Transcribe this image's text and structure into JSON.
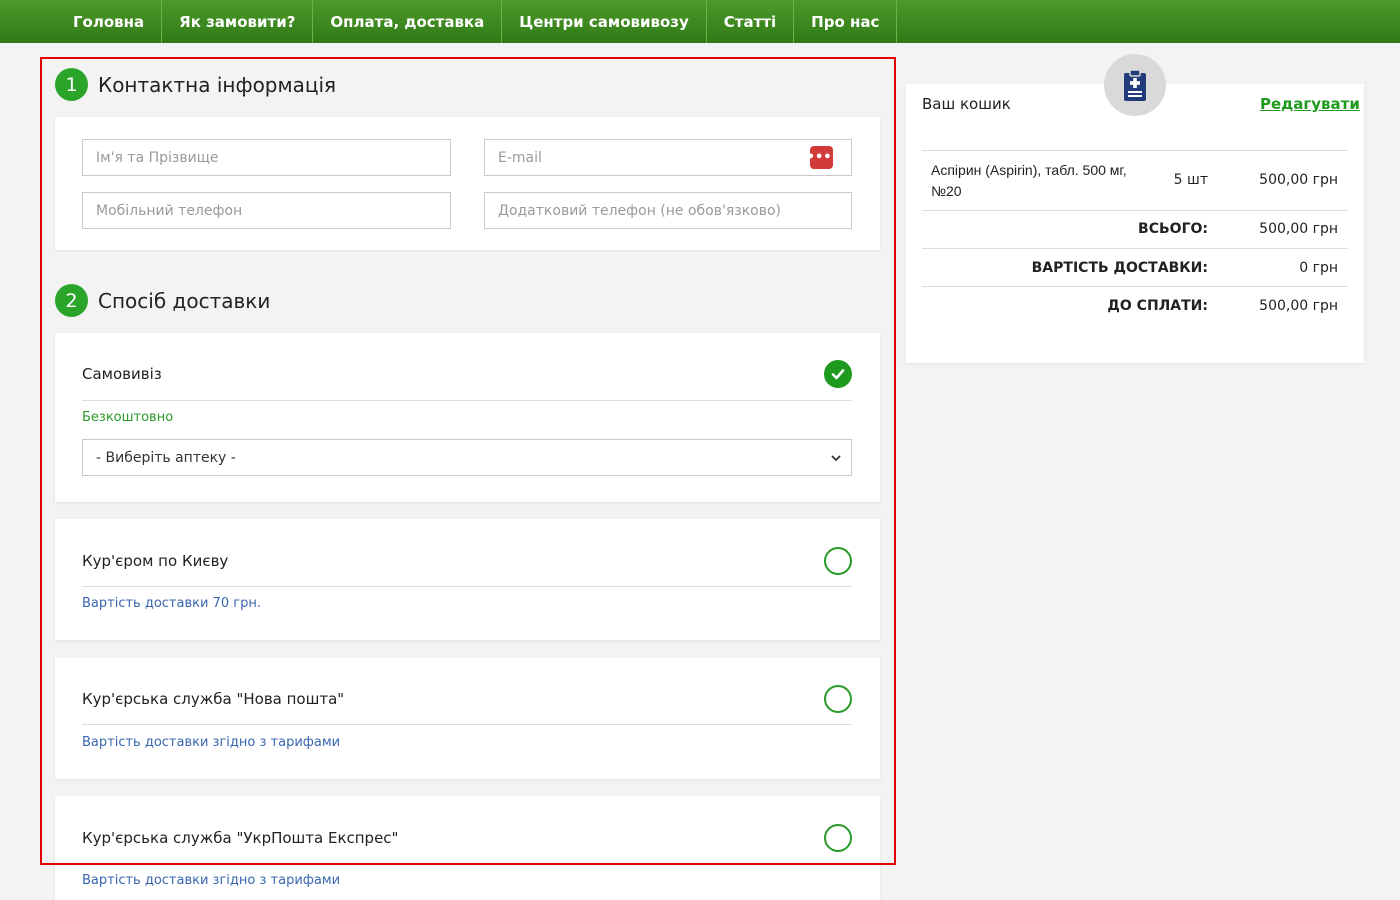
{
  "nav": {
    "items": [
      "Головна",
      "Як замовити?",
      "Оплата, доставка",
      "Центри самовивозу",
      "Статті",
      "Про нас"
    ]
  },
  "contact": {
    "number": "1",
    "title": "Контактна інформація",
    "name_placeholder": "Ім'я та Прізвище",
    "email_placeholder": "E-mail",
    "phone_placeholder": "Мобільний телефон",
    "phone2_placeholder": "Додатковий телефон (не обов'язково)",
    "email_badge": "•••|"
  },
  "delivery": {
    "number": "2",
    "title": "Спосіб доставки",
    "options": [
      {
        "title": "Самовивіз",
        "subtitle": "Безкоштовно",
        "selected": true
      },
      {
        "title": "Кур'єром по Києву",
        "subtitle": "Вартість доставки 70 грн.",
        "selected": false
      },
      {
        "title": "Кур'єрська служба \"Нова пошта\"",
        "subtitle": "Вартість доставки згідно з тарифами",
        "selected": false
      },
      {
        "title": "Кур'єрська служба \"УкрПошта Експрес\"",
        "subtitle": "Вартість доставки згідно з тарифами",
        "selected": false
      }
    ],
    "pharmacy_select": "- Виберіть аптеку -"
  },
  "cart": {
    "title": "Ваш кошик",
    "edit_label": "Редагувати",
    "item": {
      "name": "Аспірин (Aspirin), табл. 500 мг, №20",
      "qty": "5 шт",
      "price": "500,00 грн"
    },
    "total_label": "ВСЬОГО:",
    "total_value": "500,00 грн",
    "shipping_label": "ВАРТІСТЬ ДОСТАВКИ:",
    "shipping_value": "0 грн",
    "pay_label": "ДО СПЛАТИ:",
    "pay_value": "500,00 грн"
  },
  "colors": {
    "nav_green": "#3d8a20",
    "accent_green": "#2aa52a",
    "link_blue": "#3a66b0",
    "highlight_red": "#e50000"
  }
}
